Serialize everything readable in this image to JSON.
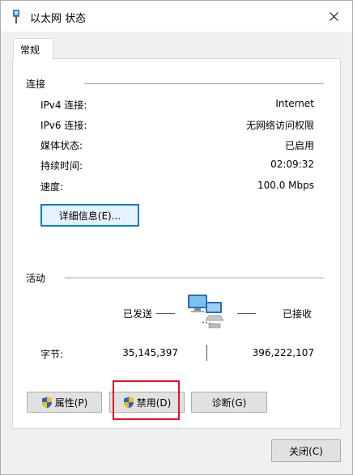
{
  "window": {
    "title": "以太网 状态"
  },
  "tabs": [
    {
      "label": "常规"
    }
  ],
  "connection": {
    "section_label": "连接",
    "rows": [
      {
        "label": "IPv4 连接:",
        "value": "Internet"
      },
      {
        "label": "IPv6 连接:",
        "value": "无网络访问权限"
      },
      {
        "label": "媒体状态:",
        "value": "已启用"
      },
      {
        "label": "持续时间:",
        "value": "02:09:32"
      },
      {
        "label": "速度:",
        "value": "100.0 Mbps"
      }
    ],
    "details_button": "详细信息(E)..."
  },
  "activity": {
    "section_label": "活动",
    "sent_label": "已发送",
    "received_label": "已接收",
    "bytes_label": "字节:",
    "bytes_sent": "35,145,397",
    "bytes_received": "396,222,107"
  },
  "buttons": {
    "properties": "属性(P)",
    "disable": "禁用(D)",
    "diagnose": "诊断(G)",
    "close": "关闭(C)"
  },
  "colors": {
    "accent": "#0078d7",
    "highlight_box": "#e81123"
  }
}
